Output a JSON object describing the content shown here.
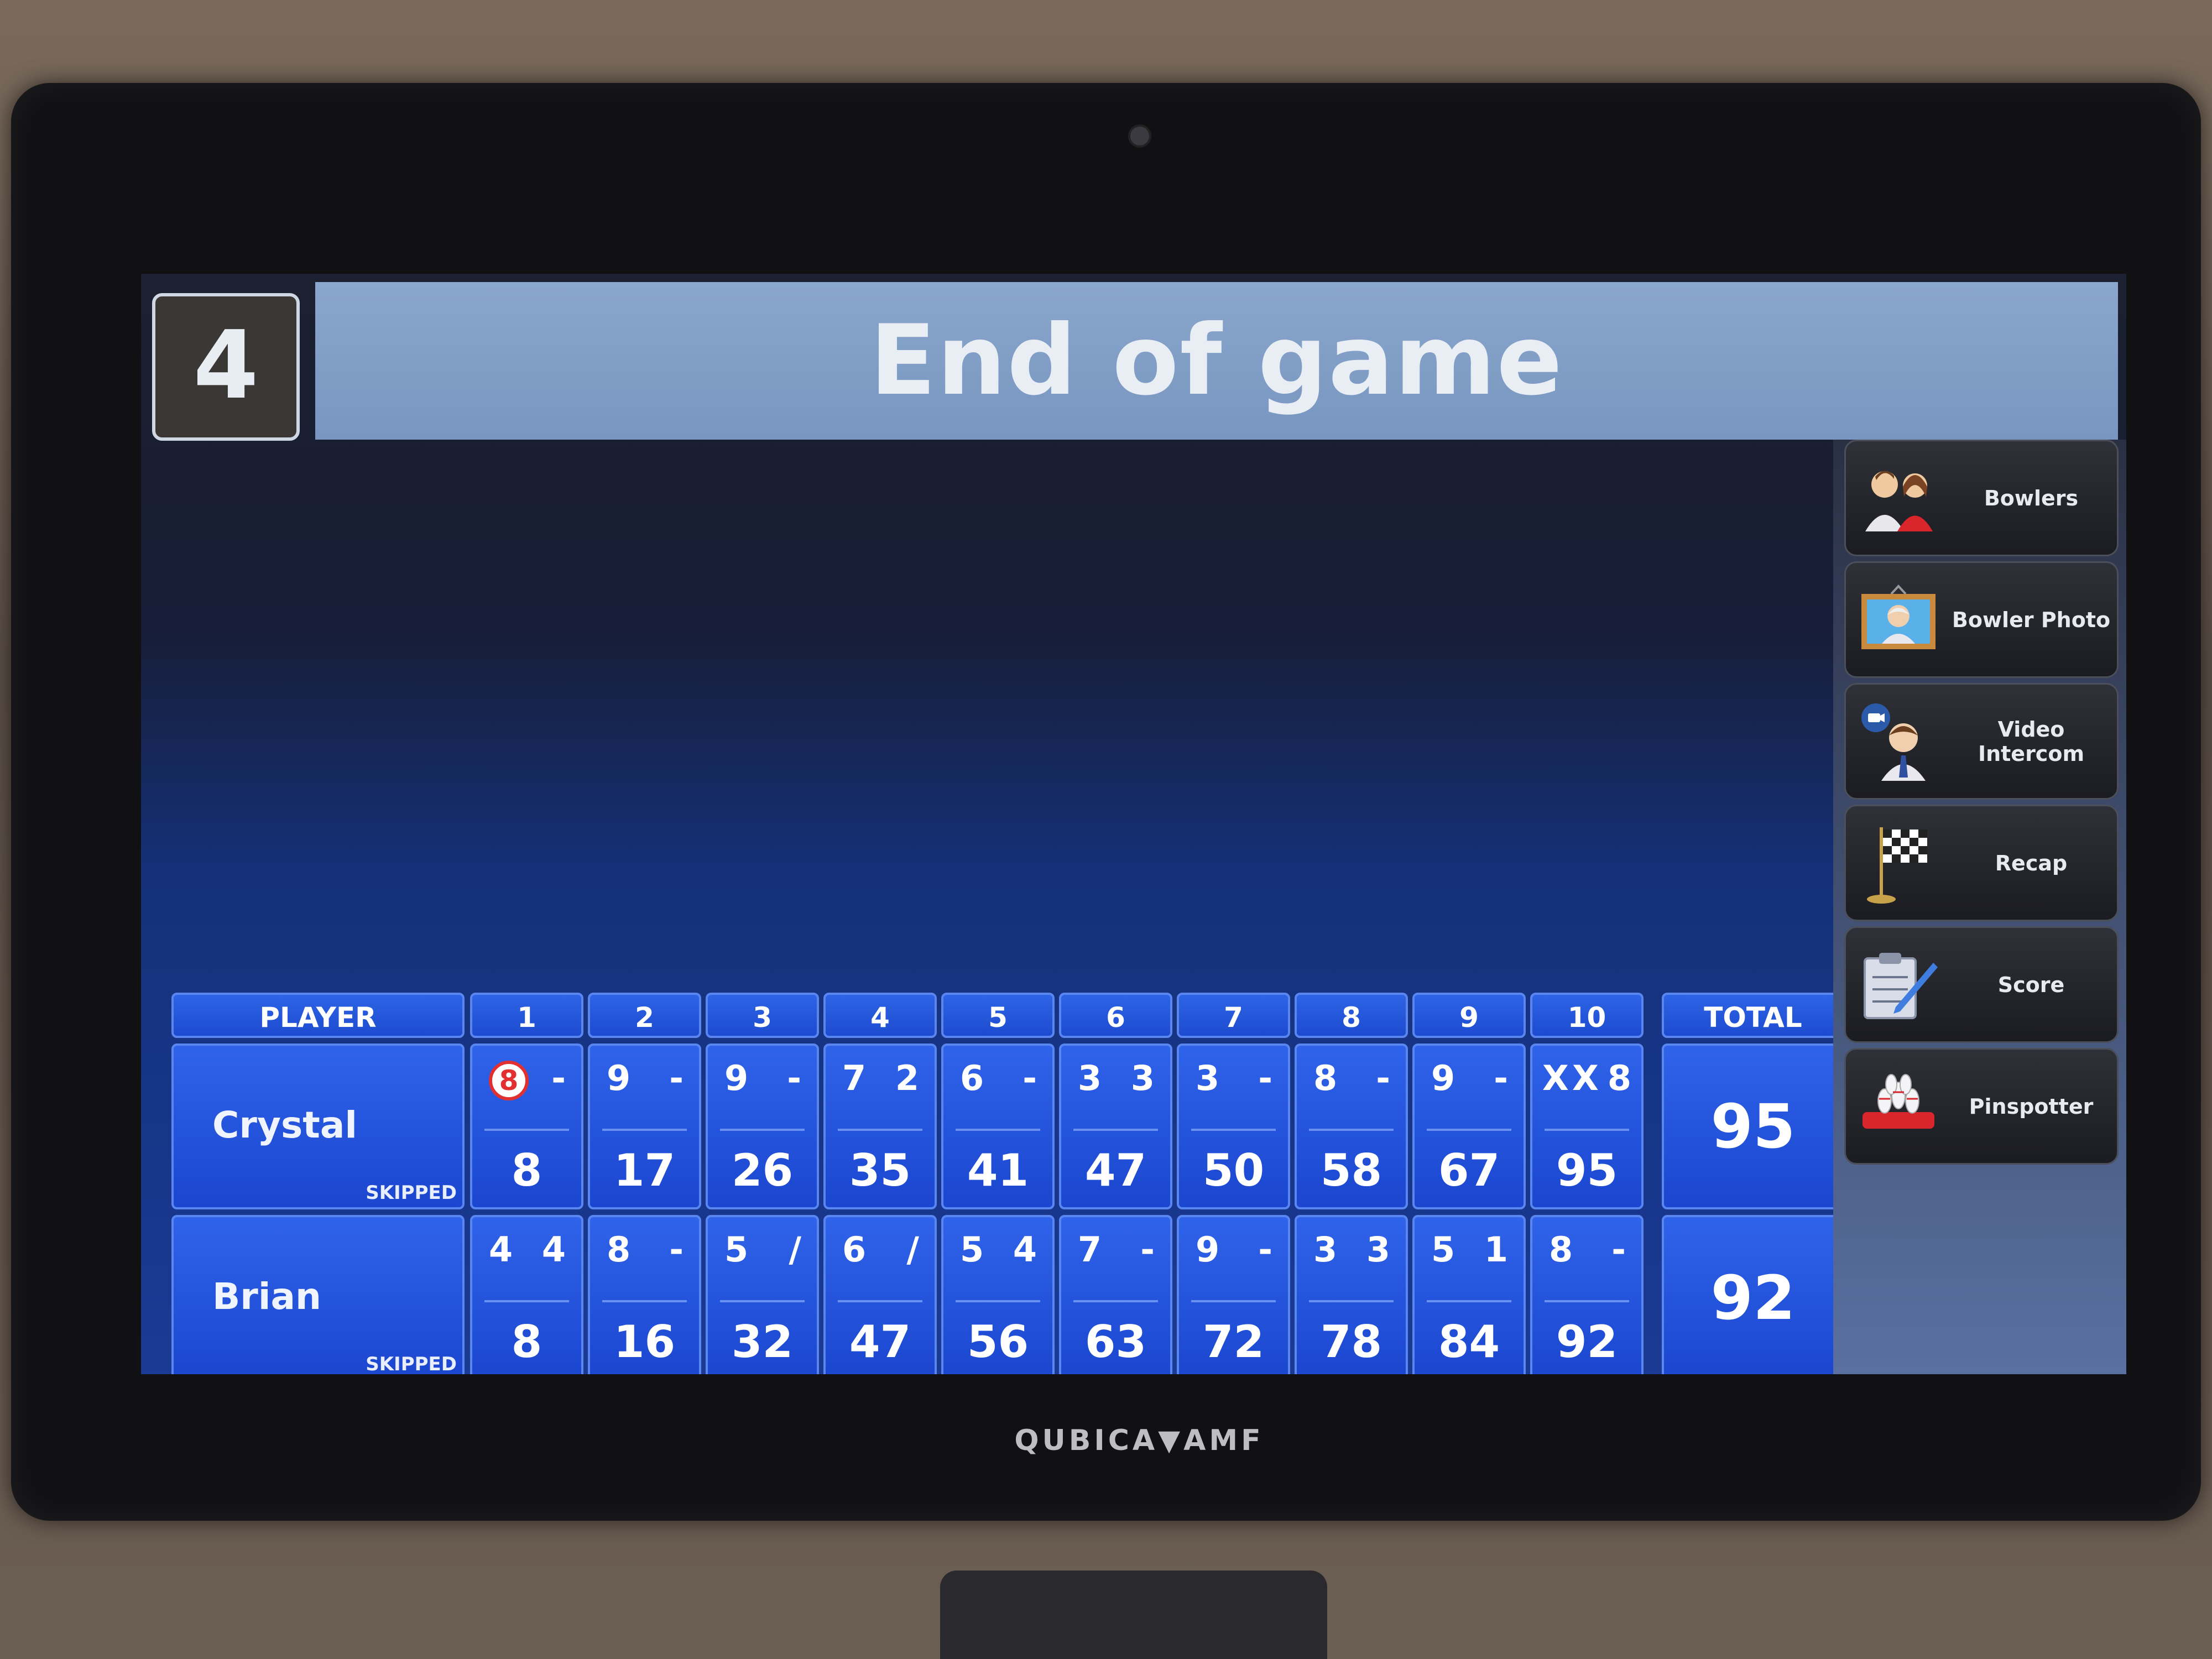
{
  "brand": "QUBICA▼AMF",
  "header": {
    "lane": "4",
    "title": "End of game"
  },
  "sidebar": {
    "items": [
      {
        "label": "Bowlers",
        "icon": "bowlers-icon"
      },
      {
        "label": "Bowler Photo",
        "icon": "bowler-photo-icon"
      },
      {
        "label": "Video Intercom",
        "icon": "video-intercom-icon"
      },
      {
        "label": "Recap",
        "icon": "checkered-flag-icon"
      },
      {
        "label": "Score",
        "icon": "score-clipboard-icon"
      },
      {
        "label": "Pinspotter",
        "icon": "pinspotter-icon"
      }
    ]
  },
  "table": {
    "headers": {
      "player": "PLAYER",
      "total": "TOTAL",
      "frames": [
        "1",
        "2",
        "3",
        "4",
        "5",
        "6",
        "7",
        "8",
        "9",
        "10"
      ]
    },
    "players": [
      {
        "name": "Crystal",
        "status": "SKIPPED",
        "total": "95",
        "frames": [
          {
            "b1": "8",
            "b2": "-",
            "run": "8",
            "split": true
          },
          {
            "b1": "9",
            "b2": "-",
            "run": "17"
          },
          {
            "b1": "9",
            "b2": "-",
            "run": "26"
          },
          {
            "b1": "7",
            "b2": "2",
            "run": "35"
          },
          {
            "b1": "6",
            "b2": "-",
            "run": "41"
          },
          {
            "b1": "3",
            "b2": "3",
            "run": "47"
          },
          {
            "b1": "3",
            "b2": "-",
            "run": "50"
          },
          {
            "b1": "8",
            "b2": "-",
            "run": "58"
          },
          {
            "b1": "9",
            "b2": "-",
            "run": "67"
          },
          {
            "b1": "X",
            "b2": "X",
            "b3": "8",
            "run": "95"
          }
        ]
      },
      {
        "name": "Brian",
        "status": "SKIPPED",
        "total": "92",
        "frames": [
          {
            "b1": "4",
            "b2": "4",
            "run": "8"
          },
          {
            "b1": "8",
            "b2": "-",
            "run": "16"
          },
          {
            "b1": "5",
            "b2": "/",
            "run": "32"
          },
          {
            "b1": "6",
            "b2": "/",
            "run": "47"
          },
          {
            "b1": "5",
            "b2": "4",
            "run": "56"
          },
          {
            "b1": "7",
            "b2": "-",
            "run": "63"
          },
          {
            "b1": "9",
            "b2": "-",
            "run": "72"
          },
          {
            "b1": "3",
            "b2": "3",
            "run": "78"
          },
          {
            "b1": "5",
            "b2": "1",
            "run": "84"
          },
          {
            "b1": "8",
            "b2": "-",
            "run": "92"
          }
        ]
      }
    ]
  }
}
